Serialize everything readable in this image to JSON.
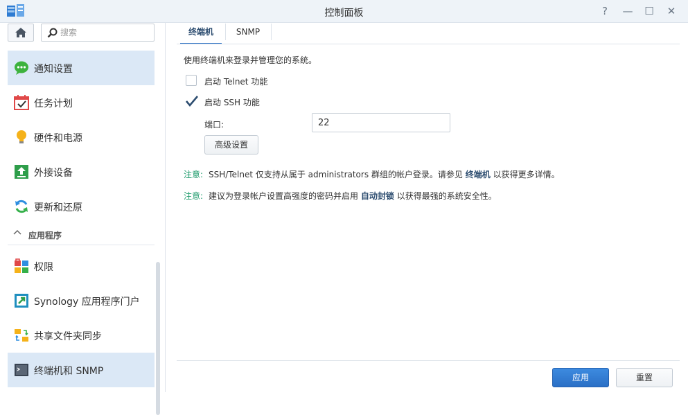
{
  "window": {
    "title": "控制面板",
    "buttons": {
      "help": "?",
      "minimize": "—",
      "maximize": "☐",
      "close": "✕"
    }
  },
  "sidebar": {
    "search_placeholder": "搜索",
    "items": [
      {
        "label": "通知设置",
        "icon": "notification-icon",
        "active": true
      },
      {
        "label": "任务计划",
        "icon": "task-scheduler-icon"
      },
      {
        "label": "硬件和电源",
        "icon": "hardware-power-icon"
      },
      {
        "label": "外接设备",
        "icon": "external-devices-icon"
      },
      {
        "label": "更新和还原",
        "icon": "update-restore-icon"
      }
    ],
    "section_label": "应用程序",
    "app_items": [
      {
        "label": "权限",
        "icon": "privileges-icon"
      },
      {
        "label": "Synology 应用程序门户",
        "icon": "app-portal-icon"
      },
      {
        "label": "共享文件夹同步",
        "icon": "shared-folder-sync-icon"
      },
      {
        "label": "终端机和 SNMP",
        "icon": "terminal-snmp-icon",
        "active": true
      }
    ]
  },
  "tabs": [
    {
      "label": "终端机",
      "active": true
    },
    {
      "label": "SNMP",
      "active": false
    }
  ],
  "main": {
    "description": "使用终端机来登录并管理您的系统。",
    "telnet_label": "启动 Telnet 功能",
    "telnet_checked": false,
    "ssh_label": "启动 SSH 功能",
    "ssh_checked": true,
    "port_label": "端口:",
    "port_value": "22",
    "advanced_button": "高级设置",
    "note1": {
      "tag": "注意:",
      "text": "SSH/Telnet 仅支持从属于 administrators 群组的帐户登录。请参见",
      "link": "终端机",
      "after": "以获得更多详情。"
    },
    "note2": {
      "tag": "注意:",
      "text": "建议为登录帐户设置高强度的密码并启用",
      "link": "自动封锁",
      "after": "以获得最强的系统安全性。"
    }
  },
  "footer": {
    "apply": "应用",
    "reset": "重置"
  },
  "colors": {
    "accent": "#2a6fc6",
    "note_tag": "#1b9a6a",
    "active_bg": "#dbe8f6"
  }
}
